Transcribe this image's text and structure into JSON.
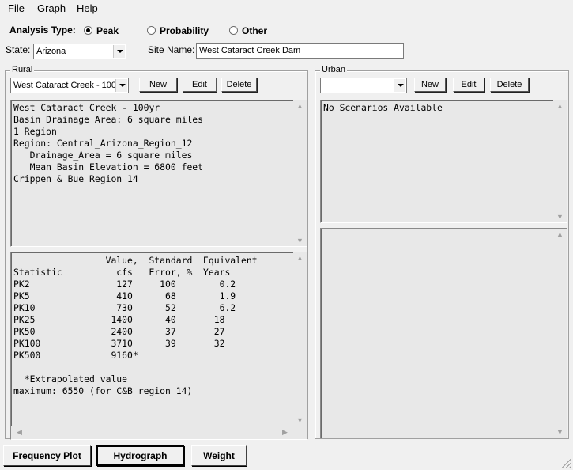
{
  "menu": {
    "file": "File",
    "graph": "Graph",
    "help": "Help"
  },
  "analysis": {
    "label": "Analysis Type:",
    "options": [
      {
        "label": "Peak",
        "selected": true
      },
      {
        "label": "Probability",
        "selected": false
      },
      {
        "label": "Other",
        "selected": false
      }
    ]
  },
  "state": {
    "label": "State:",
    "value": "Arizona"
  },
  "site": {
    "label": "Site Name:",
    "value": "West Cataract Creek Dam"
  },
  "rural": {
    "title": "Rural",
    "scenario_value": "West Cataract Creek - 100",
    "new_label": "New",
    "edit_label": "Edit",
    "delete_label": "Delete",
    "description": "West Cataract Creek - 100yr\nBasin Drainage Area: 6 square miles\n1 Region\nRegion: Central_Arizona_Region_12\n   Drainage_Area = 6 square miles\n   Mean_Basin_Elevation = 6800 feet\nCrippen & Bue Region 14",
    "results": "                 Value,  Standard  Equivalent\nStatistic          cfs   Error, %  Years\nPK2                127     100        0.2\nPK5                410      68        1.9\nPK10               730      52        6.2\nPK25              1400      40       18\nPK50              2400      37       27\nPK100             3710      39       32\nPK500             9160*\n\n  *Extrapolated value\nmaximum: 6550 (for C&B region 14)"
  },
  "urban": {
    "title": "Urban",
    "scenario_value": "",
    "new_label": "New",
    "edit_label": "Edit",
    "delete_label": "Delete",
    "description": "No Scenarios Available",
    "results": ""
  },
  "bottom_tabs": [
    {
      "label": "Frequency Plot",
      "active": false
    },
    {
      "label": "Hydrograph",
      "active": true
    },
    {
      "label": "Weight",
      "active": false
    }
  ]
}
